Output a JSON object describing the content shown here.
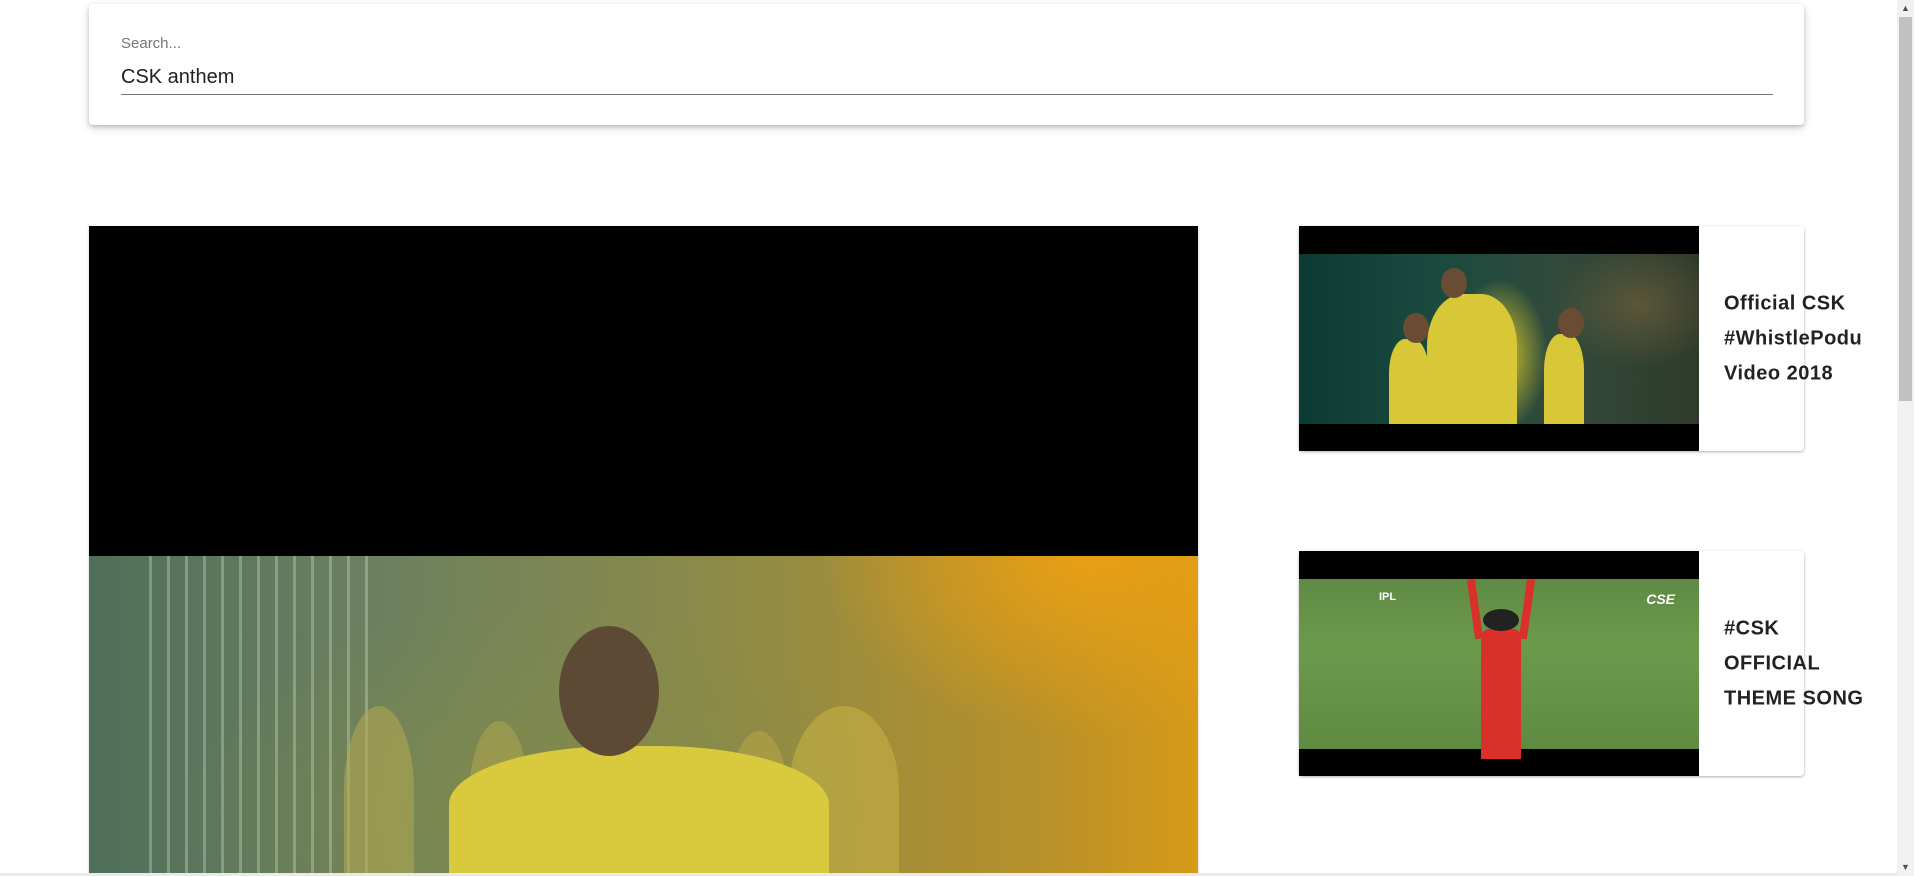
{
  "search": {
    "label": "Search...",
    "value": "CSK anthem"
  },
  "main_player": {
    "icon": "video-frame"
  },
  "videos": [
    {
      "title": "Official CSK #WhistlePodu Video 2018"
    },
    {
      "title": "#CSK OFFICIAL THEME SONG",
      "thumb_logos": [
        "IPL",
        "CSE"
      ]
    }
  ],
  "scrollbar": {
    "up_icon": "▲",
    "down_icon": "▼"
  }
}
